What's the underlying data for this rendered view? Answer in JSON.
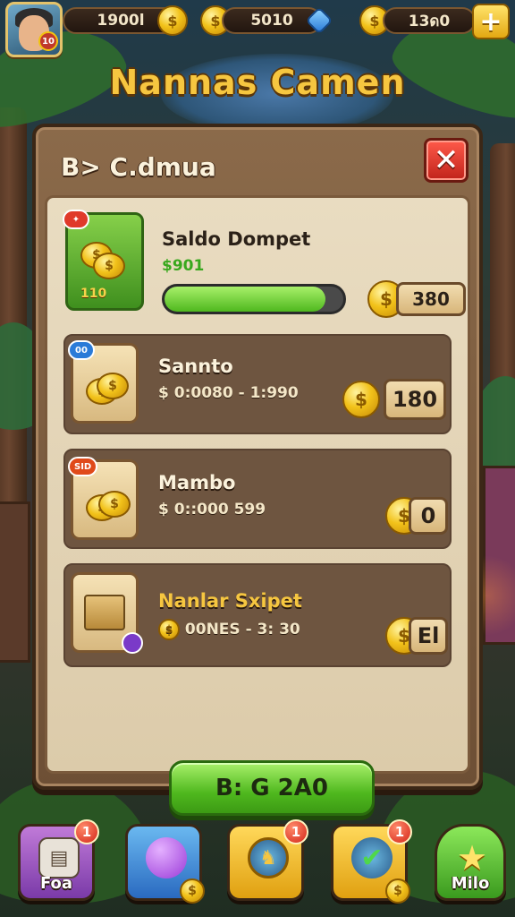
{
  "hud": {
    "resource_1": "1900l",
    "resource_2": "5010",
    "resource_3": "13ด0",
    "avatar_badge": "10"
  },
  "game_title": "Nannas Camen",
  "panel": {
    "title": "B> C.dmua",
    "close_icon": "close-icon"
  },
  "rows": [
    {
      "title": "Saldo Dompet",
      "subtitle": "$901",
      "badge": "110",
      "progress_fraction": 0.9,
      "price": "380"
    },
    {
      "title": "Sannto",
      "subtitle": "$ 0:0080 - 1:990",
      "tag": "00",
      "price": "180"
    },
    {
      "title": "Mambo",
      "subtitle": "$ 0::000 599",
      "tag": "SID",
      "price": "0"
    },
    {
      "title": "Nanlar Sxipet",
      "subtitle": "00NES - 3: 30",
      "price": "El"
    }
  ],
  "main_button": {
    "label": "B: G 2A0"
  },
  "nav": [
    {
      "label": "Foa",
      "badge": "1",
      "icon": "book-icon"
    },
    {
      "label": "",
      "badge": "",
      "icon": "shop-icon"
    },
    {
      "label": "",
      "badge": "1",
      "icon": "shield-icon"
    },
    {
      "label": "",
      "badge": "1",
      "icon": "quest-icon"
    },
    {
      "label": "Milo",
      "badge": "",
      "icon": "star-icon"
    }
  ],
  "colors": {
    "accent_gold": "#f6c640",
    "button_green": "#4fb81e",
    "close_red": "#c0221a",
    "panel_brown": "#6d4f35"
  }
}
